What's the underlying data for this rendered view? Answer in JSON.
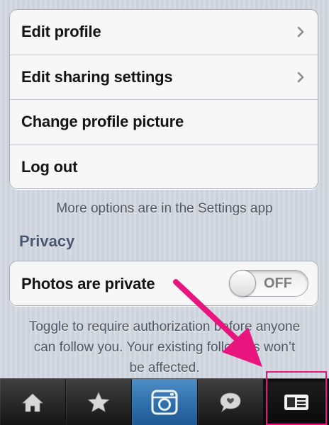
{
  "settings_menu": {
    "items": [
      {
        "label": "Edit profile",
        "icon": "chevron-right-icon"
      },
      {
        "label": "Edit sharing settings",
        "icon": "chevron-right-icon"
      },
      {
        "label": "Change profile picture"
      },
      {
        "label": "Log out"
      }
    ],
    "note": "More options are in the Settings app"
  },
  "privacy": {
    "title": "Privacy",
    "toggle_label": "Photos are private",
    "toggle_state": "OFF",
    "help_text": "Toggle to require authorization before anyone can follow you. Your existing followers won’t be affected."
  },
  "tabbar": {
    "tabs": [
      {
        "icon": "home-icon"
      },
      {
        "icon": "star-icon"
      },
      {
        "icon": "camera-icon"
      },
      {
        "icon": "speech-bubble-icon"
      },
      {
        "icon": "profile-card-icon",
        "selected": true
      }
    ]
  },
  "annotation": {
    "color": "#e8157f"
  }
}
